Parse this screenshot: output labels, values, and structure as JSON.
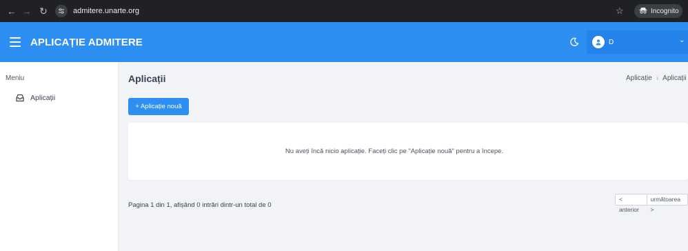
{
  "browser": {
    "url": "admitere.unarte.org",
    "incognito_label": "Incognito"
  },
  "header": {
    "title": "APLICAȚIE ADMITERE",
    "user_name": "D"
  },
  "sidebar": {
    "heading": "Meniu",
    "items": [
      {
        "label": "Aplicații",
        "icon": "inbox-icon"
      }
    ]
  },
  "main": {
    "page_title": "Aplicații",
    "breadcrumb": [
      "Aplicație",
      "Aplicații"
    ],
    "new_button_label": "+ Aplicație nouă",
    "empty_message": "Nu aveți încă nicio aplicație. Faceți clic pe \"Aplicație nouă\" pentru a începe.",
    "pagination_info": "Pagina 1 din 1, afișând 0 intrări dintr-un total de 0",
    "pager": {
      "prev": "< anterior",
      "next": "următoarea >"
    }
  },
  "colors": {
    "brand": "#2c8ff1",
    "browser_chrome": "#202124",
    "page_background": "#f1f3f6"
  }
}
